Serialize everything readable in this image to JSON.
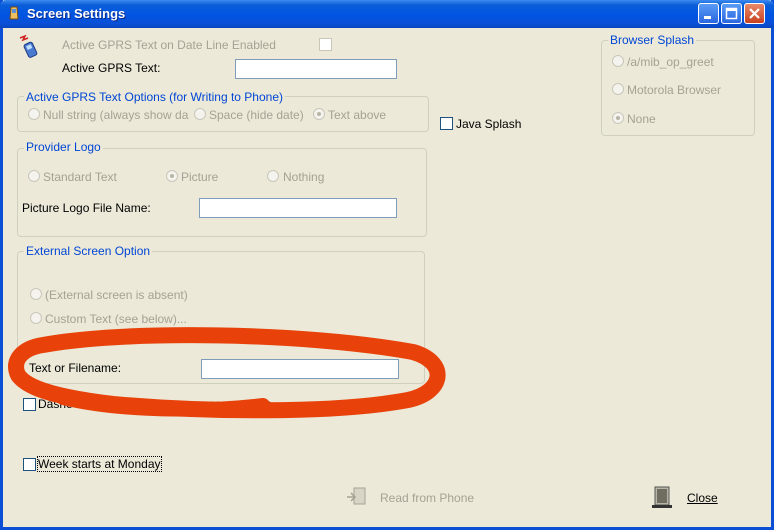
{
  "window": {
    "title": "Screen Settings",
    "controls": [
      "minimize",
      "maximize",
      "close"
    ]
  },
  "gprs": {
    "date_line_label": "Active GPRS Text on Date Line Enabled",
    "text_label": "Active GPRS Text:",
    "text_value": ""
  },
  "gprs_options": {
    "title": "Active GPRS Text Options (for Writing to Phone)",
    "options": [
      {
        "label": "Null string (always show da",
        "selected": false
      },
      {
        "label": "Space (hide date)",
        "selected": false
      },
      {
        "label": "Text above",
        "selected": true
      }
    ]
  },
  "java_splash": {
    "label": "Java Splash",
    "checked": false
  },
  "browser_splash": {
    "title": "Browser Splash",
    "options": [
      {
        "label": "/a/mib_op_greet",
        "selected": false
      },
      {
        "label": "Motorola Browser",
        "selected": false
      },
      {
        "label": "None",
        "selected": true
      }
    ]
  },
  "provider_logo": {
    "title": "Provider Logo",
    "options": [
      {
        "label": "Standard Text",
        "selected": false
      },
      {
        "label": "Picture",
        "selected": true
      },
      {
        "label": "Nothing",
        "selected": false
      }
    ],
    "file_label": "Picture Logo File Name:",
    "file_value": ""
  },
  "external_screen": {
    "title": "External Screen Option",
    "options": [
      {
        "label": "(External screen is absent)",
        "selected": false
      },
      {
        "label": "Custom Text (see below)...",
        "selected": false
      }
    ],
    "file_label": "Text or Filename:",
    "file_value": ""
  },
  "dashes": {
    "label_start": "Dashe",
    "label_end": "ne numbers",
    "checked": false
  },
  "week": {
    "label": "Week starts at Monday",
    "checked": false
  },
  "footer": {
    "read_label": "Read from Phone",
    "close_label": "Close"
  },
  "colors": {
    "titlebar": "#0054e3",
    "group_title": "#0046d5",
    "face": "#ece9d8",
    "annotation": "#e8420a"
  }
}
